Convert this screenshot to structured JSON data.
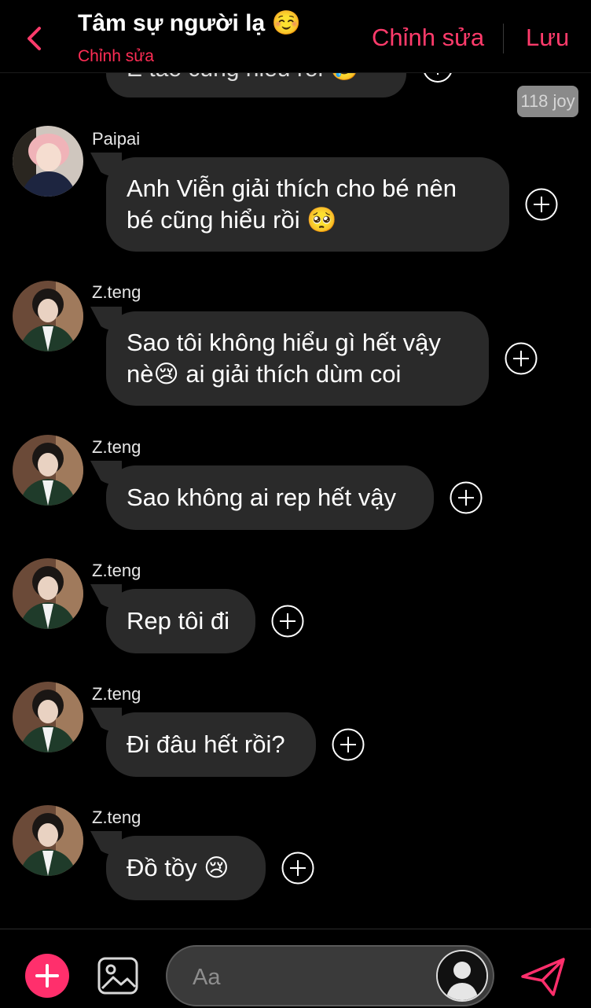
{
  "header": {
    "title": "Tâm sự người lạ ☺️",
    "subtitle": "Chỉnh sửa",
    "edit_label": "Chỉnh sửa",
    "save_label": "Lưu",
    "accent": "#ff3b6b"
  },
  "partial_message": {
    "text": "E tao cũng hiểu rồi 🥲",
    "joy_count": "118 joy"
  },
  "messages": [
    {
      "sender": "Paipai",
      "lines": [
        "Anh Viễn giải thích cho bé nên",
        "bé cũng hiểu rồi 🥺"
      ]
    },
    {
      "sender": "Z.teng",
      "lines": [
        "Sao tôi không hiểu gì hết vậy",
        "nè😢 ai giải thích dùm coi"
      ]
    },
    {
      "sender": "Z.teng",
      "lines": [
        "Sao không ai rep hết vậy"
      ]
    },
    {
      "sender": "Z.teng",
      "lines": [
        "Rep tôi đi"
      ]
    },
    {
      "sender": "Z.teng",
      "lines": [
        "Đi đâu hết rồi?"
      ]
    },
    {
      "sender": "Z.teng",
      "lines": [
        "Đồ tồy 😢"
      ]
    }
  ],
  "composer": {
    "placeholder": "Aa"
  },
  "colors": {
    "background": "#000000",
    "bubble": "#2a2a2a",
    "accent_pink": "#ff2f6c"
  },
  "icons": [
    "back-chevron-icon",
    "plus-circle-icon",
    "add-icon",
    "image-icon",
    "user-avatar-icon",
    "send-icon"
  ]
}
